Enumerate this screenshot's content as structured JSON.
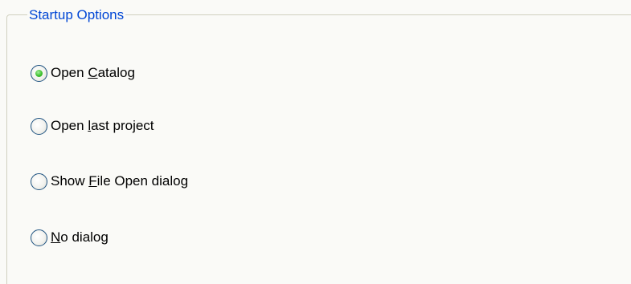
{
  "group": {
    "title": "Startup Options"
  },
  "options": [
    {
      "before": "Open ",
      "accel": "C",
      "after": "atalog",
      "checked": true
    },
    {
      "before": "Open ",
      "accel": "l",
      "after": "ast project",
      "checked": false
    },
    {
      "before": "Show ",
      "accel": "F",
      "after": "ile Open dialog",
      "checked": false
    },
    {
      "before": "",
      "accel": "N",
      "after": "o dialog",
      "checked": false
    }
  ],
  "colors": {
    "legend_text": "#0046d5",
    "groupbox_border": "#d0d0bf",
    "radio_border": "#1c5180",
    "radio_dot": "#3ec22f",
    "panel_background": "#fafaf7"
  }
}
